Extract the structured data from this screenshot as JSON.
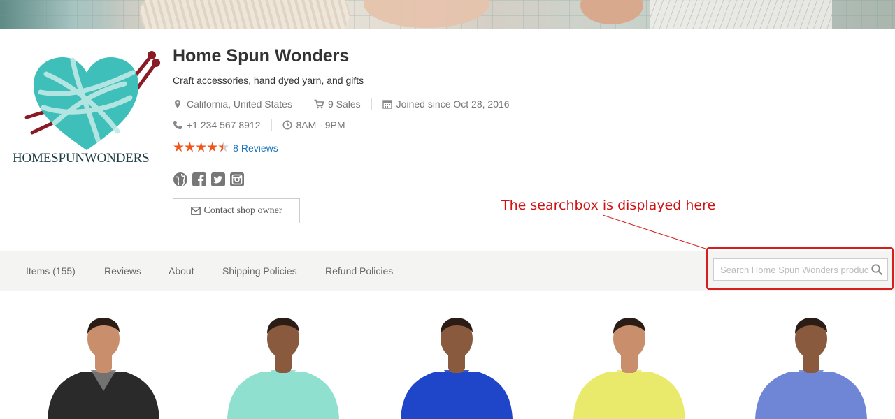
{
  "shop": {
    "name": "Home Spun Wonders",
    "description": "Craft accessories, hand dyed yarn, and gifts",
    "logo_text": "HOMESPUNWONDERS",
    "location": "California, United States",
    "sales": "9 Sales",
    "joined": "Joined since Oct 28, 2016",
    "phone": "+1 234 567 8912",
    "hours": "8AM - 9PM",
    "rating": 4.5,
    "reviews_link": "8 Reviews",
    "social_icons": [
      "globe-icon",
      "facebook-icon",
      "twitter-icon",
      "instagram-icon"
    ],
    "contact_label": "Contact shop owner"
  },
  "annotation": {
    "text": "The searchbox is displayed here",
    "color": "#d21212"
  },
  "nav": {
    "tabs": [
      {
        "label": "Items (155)"
      },
      {
        "label": "Reviews"
      },
      {
        "label": "About"
      },
      {
        "label": "Shipping Policies"
      },
      {
        "label": "Refund Policies"
      }
    ],
    "search_placeholder": "Search Home Spun Wonders products"
  },
  "products": [
    {
      "shirt_color": "#2a2a2a",
      "inner_color": "#7a7a7a"
    },
    {
      "shirt_color": "#8fe0cf",
      "inner_color": "#8fe0cf"
    },
    {
      "shirt_color": "#1f45c9",
      "inner_color": "#1f45c9"
    },
    {
      "shirt_color": "#e9ea6c",
      "inner_color": "#e9ea6c"
    },
    {
      "shirt_color": "#6f86d6",
      "inner_color": "#6f86d6"
    }
  ],
  "colors": {
    "accent_star": "#f2541a",
    "link": "#1b75bb",
    "logo_heart": "#3fbfb9",
    "annotation_red": "#d81d1d"
  }
}
